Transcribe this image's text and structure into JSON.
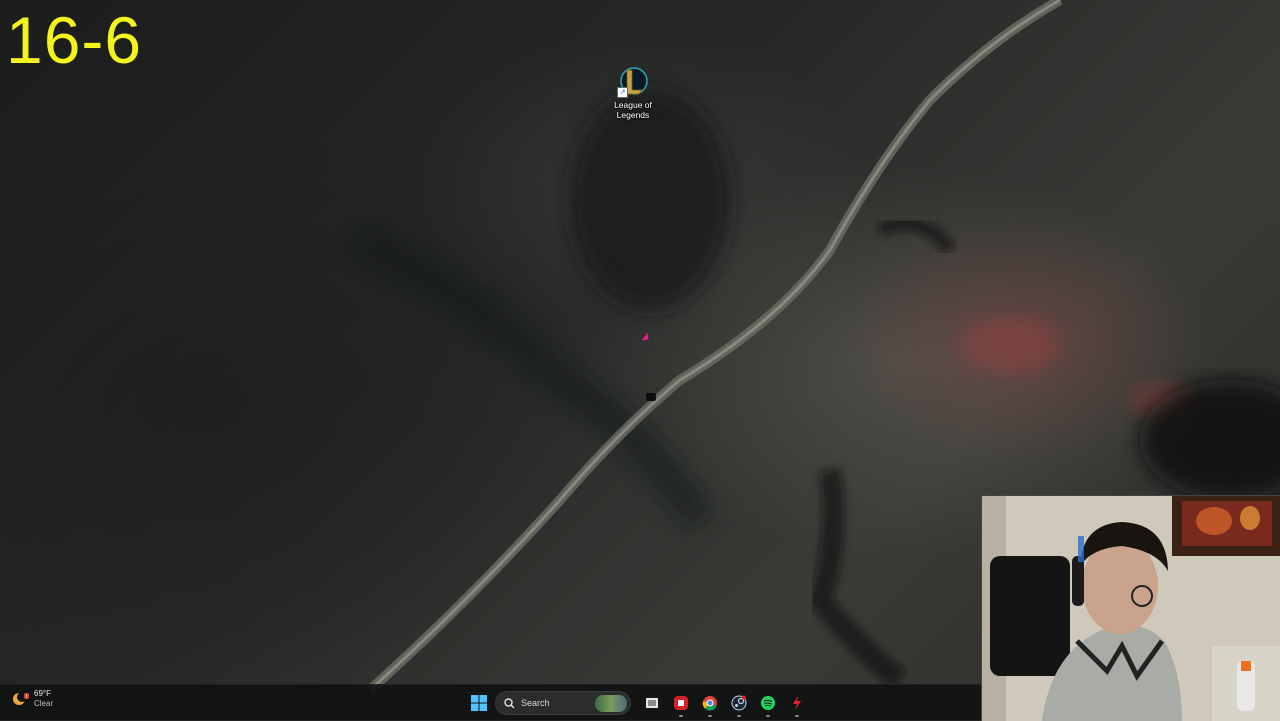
{
  "overlay": {
    "counter_text": "16-6",
    "counter_color": "#f4f41a"
  },
  "desktop": {
    "icons": [
      {
        "label": "League of\nLegends",
        "icon": "league-of-legends-icon"
      }
    ]
  },
  "taskbar": {
    "weather": {
      "temperature": "69°F",
      "condition": "Clear",
      "icon": "moon-cloud-icon"
    },
    "start_icon": "windows-start-icon",
    "search_label": "Search",
    "pinned": [
      {
        "name": "task-view",
        "icon": "task-view-icon",
        "running": false
      },
      {
        "name": "red-app",
        "icon": "red-app-icon",
        "running": true
      },
      {
        "name": "chrome",
        "icon": "chrome-icon",
        "running": true
      },
      {
        "name": "steam",
        "icon": "steam-icon",
        "running": true
      },
      {
        "name": "spotify",
        "icon": "spotify-icon",
        "running": true
      },
      {
        "name": "red-lightning-app",
        "icon": "lightning-icon",
        "running": true
      }
    ]
  },
  "webcam": {
    "description_icon": "webcam-feed"
  }
}
